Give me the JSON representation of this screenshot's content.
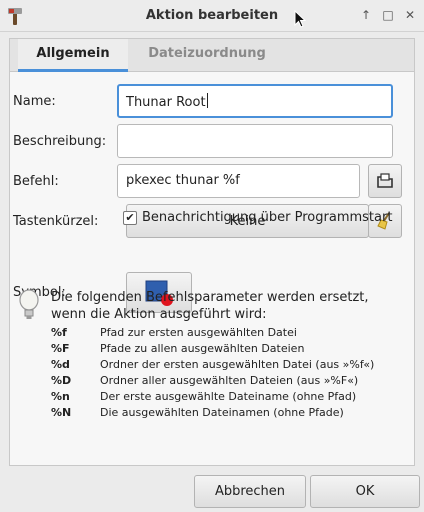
{
  "window": {
    "title": "Aktion bearbeiten",
    "controls": [
      "↑",
      "□",
      "✕"
    ]
  },
  "tabs": [
    {
      "label": "Allgemein",
      "active": true
    },
    {
      "label": "Dateizuordnung",
      "active": false
    }
  ],
  "form": {
    "name_label": "Name:",
    "name_value": "Thunar Root",
    "description_label": "Beschreibung:",
    "description_value": "",
    "command_label": "Befehl:",
    "command_value": "pkexec thunar %f",
    "shortcut_label": "Tastenkürzel:",
    "shortcut_value": "Keine",
    "startup_notify_label": "Benachrichtigung über Programmstart",
    "startup_notify_checked": true,
    "symbol_label": "Symbol:"
  },
  "info": {
    "text": "Die folgenden Befehlsparameter werden ersetzt, wenn die Aktion ausgeführt wird:",
    "params": [
      {
        "code": "%f",
        "desc": "Pfad zur ersten ausgewählten Datei"
      },
      {
        "code": "%F",
        "desc": "Pfade zu allen ausgewählten Dateien"
      },
      {
        "code": "%d",
        "desc": "Ordner der ersten ausgewählten Datei (aus »%f«)"
      },
      {
        "code": "%D",
        "desc": "Ordner aller ausgewählten Dateien (aus »%F«)"
      },
      {
        "code": "%n",
        "desc": "Der erste ausgewählte Dateiname (ohne Pfad)"
      },
      {
        "code": "%N",
        "desc": "Die ausgewählten Dateinamen (ohne Pfade)"
      }
    ]
  },
  "buttons": {
    "cancel": "Abbrechen",
    "ok": "OK"
  },
  "icons": {
    "app": "tools-icon",
    "browse": "folder-browse-icon",
    "clear": "broom-icon",
    "symbol": "blue-square-red-dot-icon",
    "info": "lightbulb-icon"
  },
  "colors": {
    "accent": "#4a90d9",
    "symbol_blue": "#2f5fae",
    "symbol_red": "#e0141e"
  }
}
